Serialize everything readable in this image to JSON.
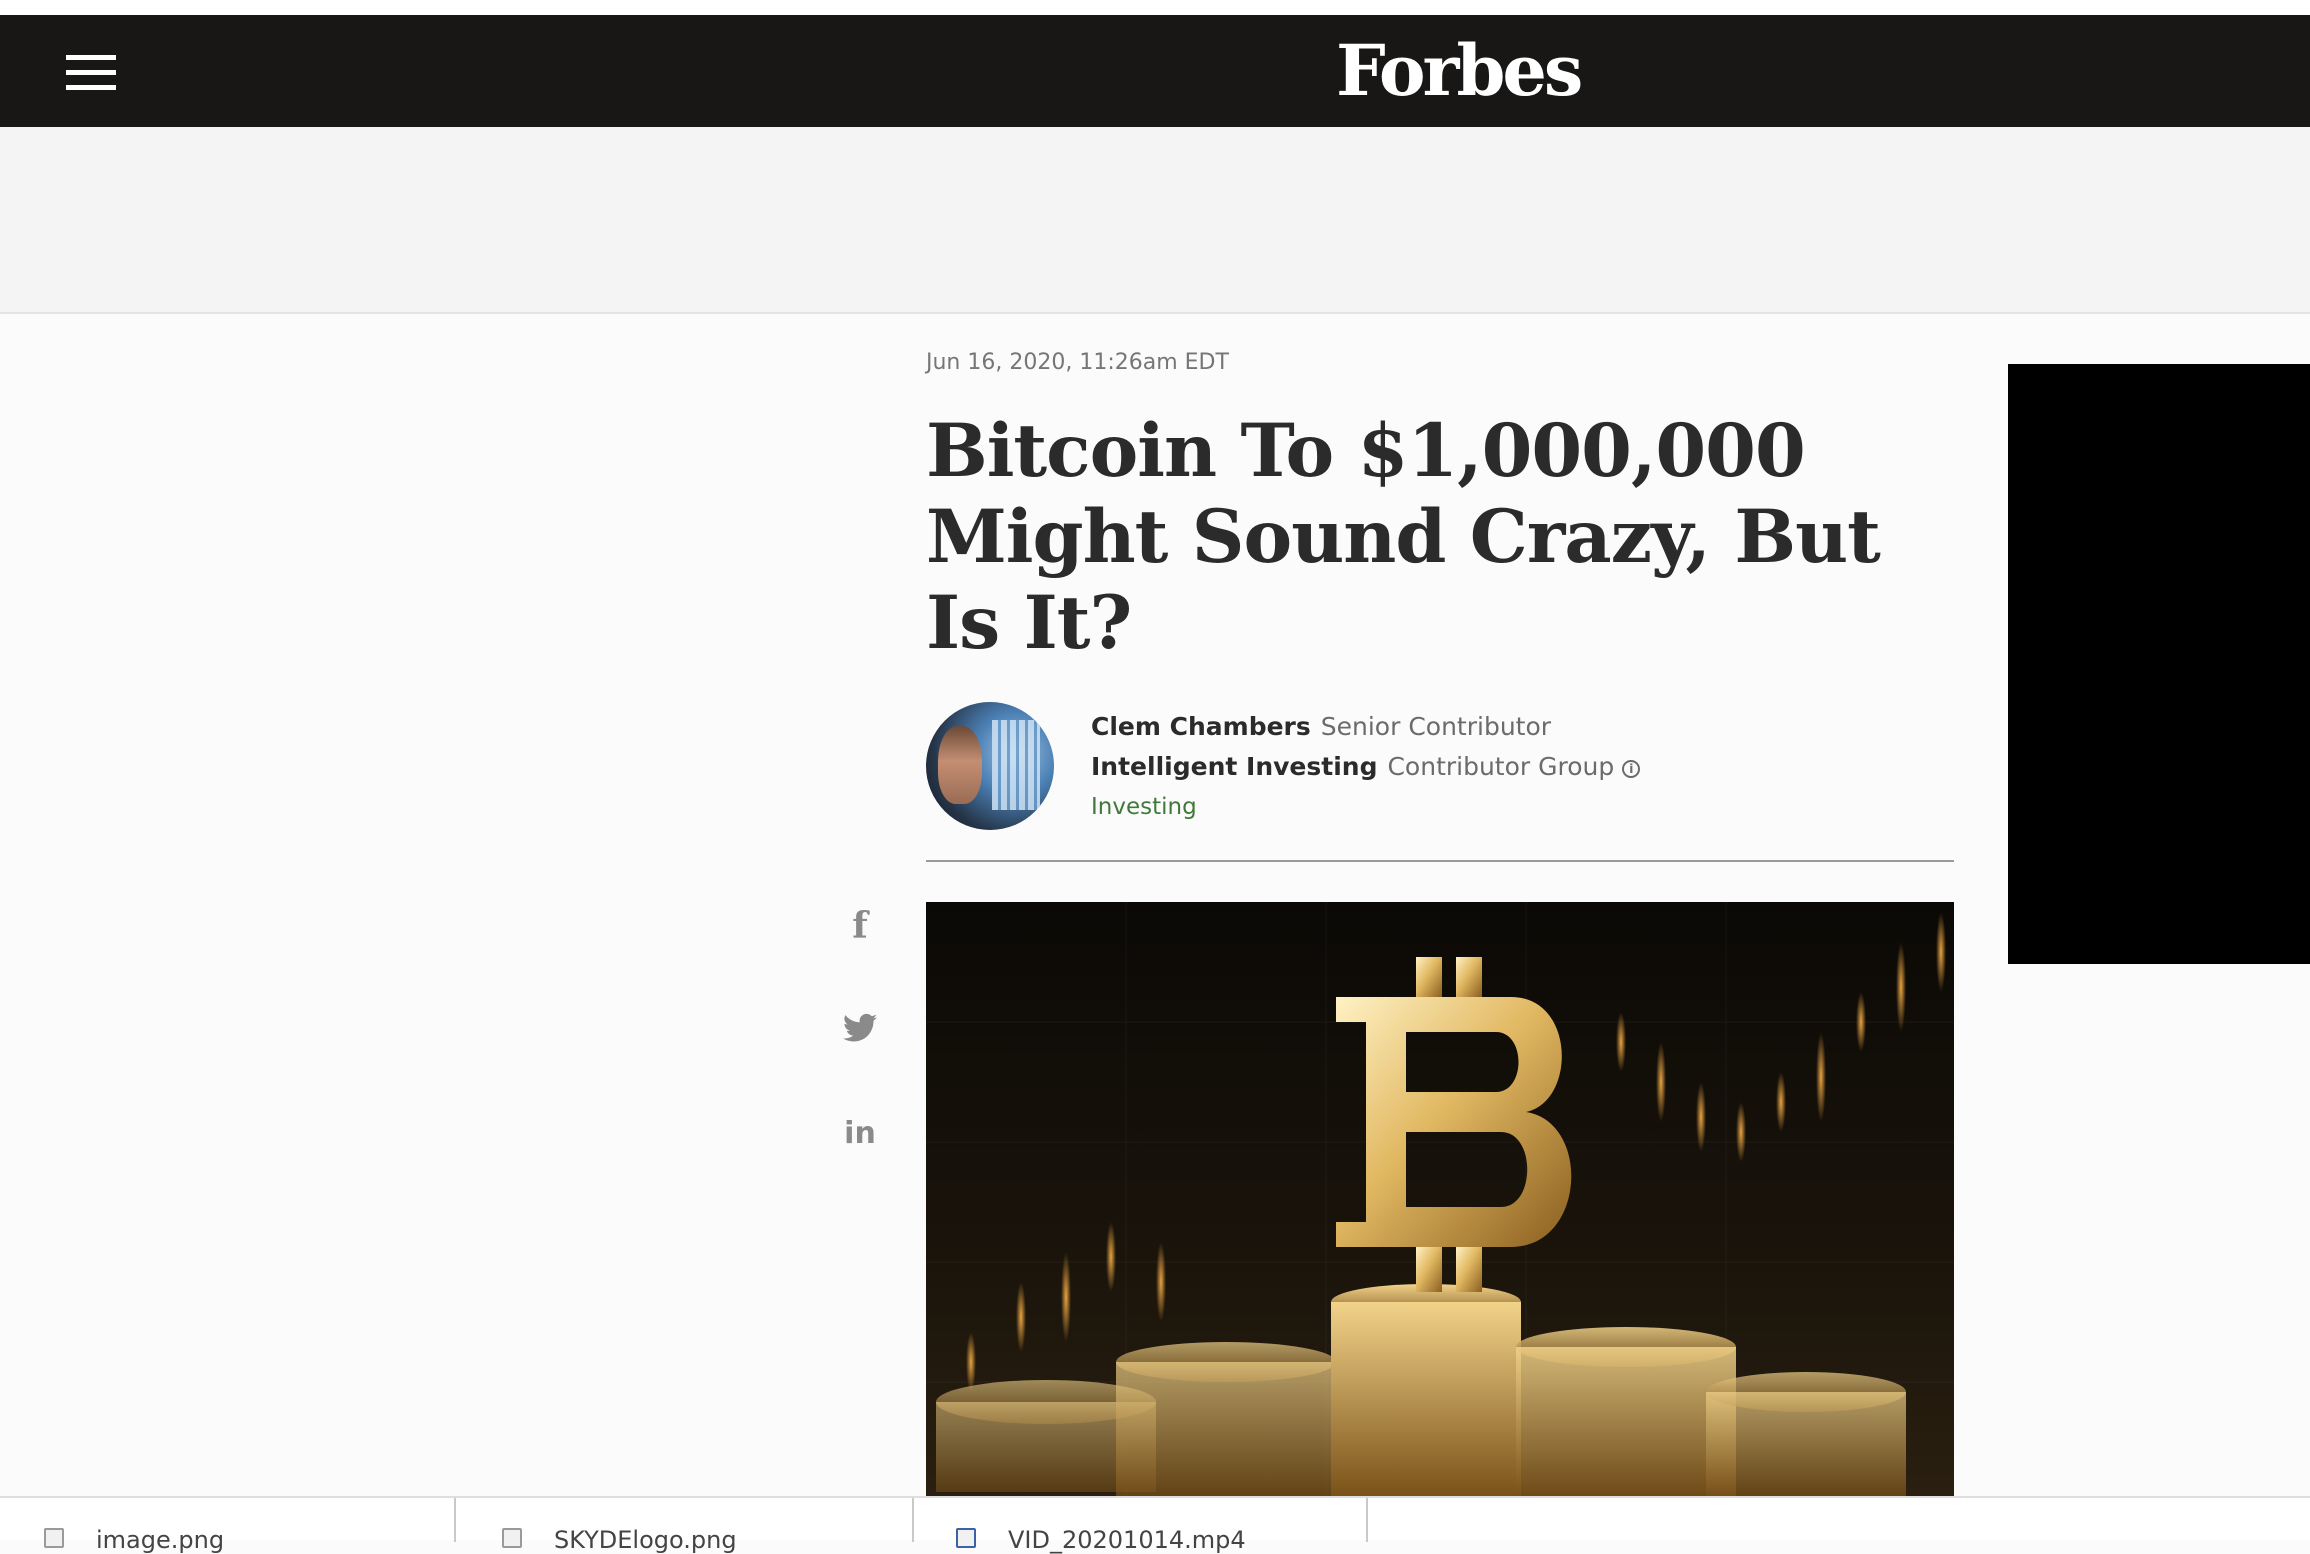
{
  "header": {
    "logo": "Forbes",
    "background": "#181716"
  },
  "article": {
    "date": "Jun 16, 2020, 11:26am EDT",
    "title": "Bitcoin To $1,000,000 Might Sound Crazy, But Is It?",
    "author": {
      "name": "Clem Chambers",
      "role": "Senior Contributor"
    },
    "group": {
      "name": "Intelligent Investing",
      "label": "Contributor Group"
    },
    "channel": "Investing",
    "channel_color": "#3f7a3a"
  },
  "share": {
    "items": [
      {
        "icon": "facebook-icon",
        "glyph": "f"
      },
      {
        "icon": "twitter-icon"
      },
      {
        "icon": "linkedin-icon",
        "glyph": "in"
      }
    ]
  },
  "downloads": {
    "items": [
      {
        "filename": "image.png",
        "icon": "file-icon"
      },
      {
        "filename": "SKYDElogo.png",
        "icon": "file-icon"
      },
      {
        "filename": "VID_20201014.mp4",
        "icon": "file-icon"
      }
    ]
  }
}
